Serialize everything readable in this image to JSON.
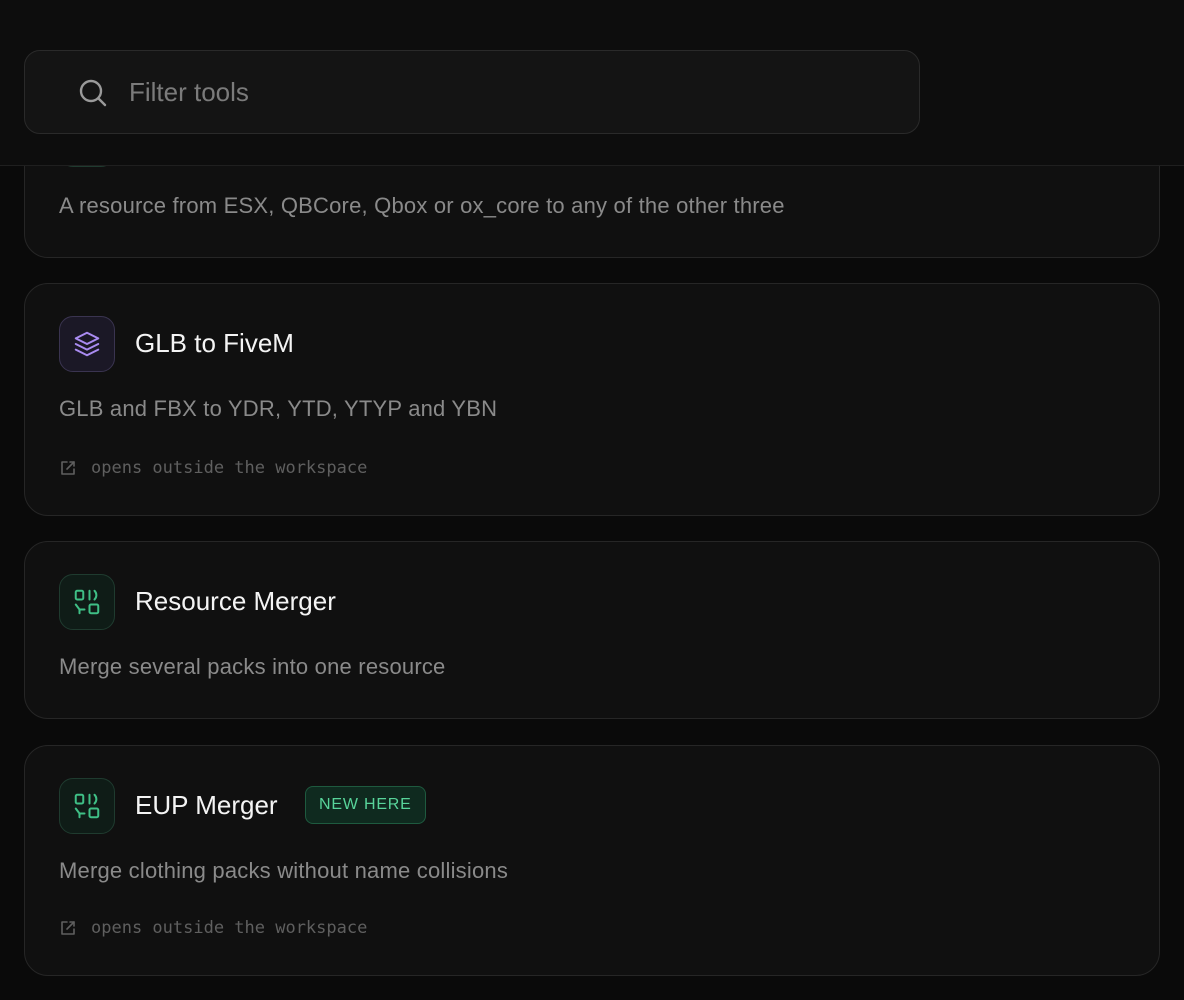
{
  "search": {
    "placeholder": "Filter tools"
  },
  "cards": [
    {
      "title": "",
      "description": "A resource from ESX, QBCore, Qbox or ox_core to any of the other three",
      "icon": "convert-icon",
      "accent": "#1f3b2f"
    },
    {
      "title": "GLB to FiveM",
      "description": "GLB and FBX to YDR, YTD, YTYP and YBN",
      "external_note": "opens outside the workspace",
      "icon": "layers-icon",
      "accent": "#9b7bea"
    },
    {
      "title": "Resource Merger",
      "description": "Merge several packs into one resource",
      "icon": "merge-icon",
      "accent": "#3fbf86"
    },
    {
      "title": "EUP Merger",
      "badge": "NEW HERE",
      "description": "Merge clothing packs without name collisions",
      "external_note": "opens outside the workspace",
      "icon": "merge-icon",
      "accent": "#3fbf86"
    }
  ]
}
